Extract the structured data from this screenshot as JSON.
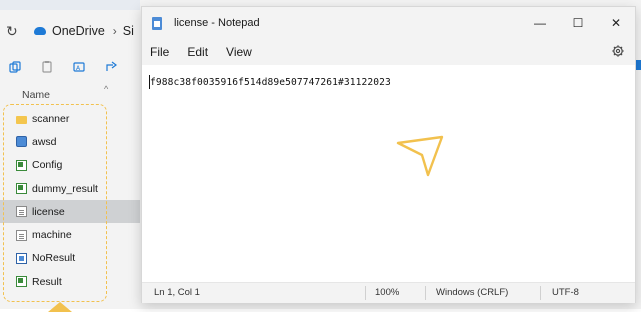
{
  "explorer": {
    "breadcrumb": {
      "item1": "OneDrive",
      "item2": "Si"
    },
    "column_header": "Name",
    "files": [
      {
        "name": "scanner",
        "icon": "folder-icon"
      },
      {
        "name": "awsd",
        "icon": "exe-icon"
      },
      {
        "name": "Config",
        "icon": "config-file-icon"
      },
      {
        "name": "dummy_result",
        "icon": "config-file-icon"
      },
      {
        "name": "license",
        "icon": "text-file-icon",
        "selected": true
      },
      {
        "name": "machine",
        "icon": "text-file-icon"
      },
      {
        "name": "NoResult",
        "icon": "doc-file-icon"
      },
      {
        "name": "Result",
        "icon": "config-file-icon"
      }
    ]
  },
  "notepad": {
    "title": "license - Notepad",
    "menu": [
      "File",
      "Edit",
      "View"
    ],
    "content": "f988c38f0035916f514d89e507747261#31122023",
    "status": {
      "position": "Ln 1, Col 1",
      "zoom": "100%",
      "line_ending": "Windows (CRLF)",
      "encoding": "UTF-8"
    },
    "controls": {
      "minimize": "—",
      "maximize": "☐",
      "close": "✕"
    }
  },
  "colors": {
    "annotation": "#f2c14e",
    "accent": "#1e7ad6",
    "selection": "#cfd1d3"
  }
}
